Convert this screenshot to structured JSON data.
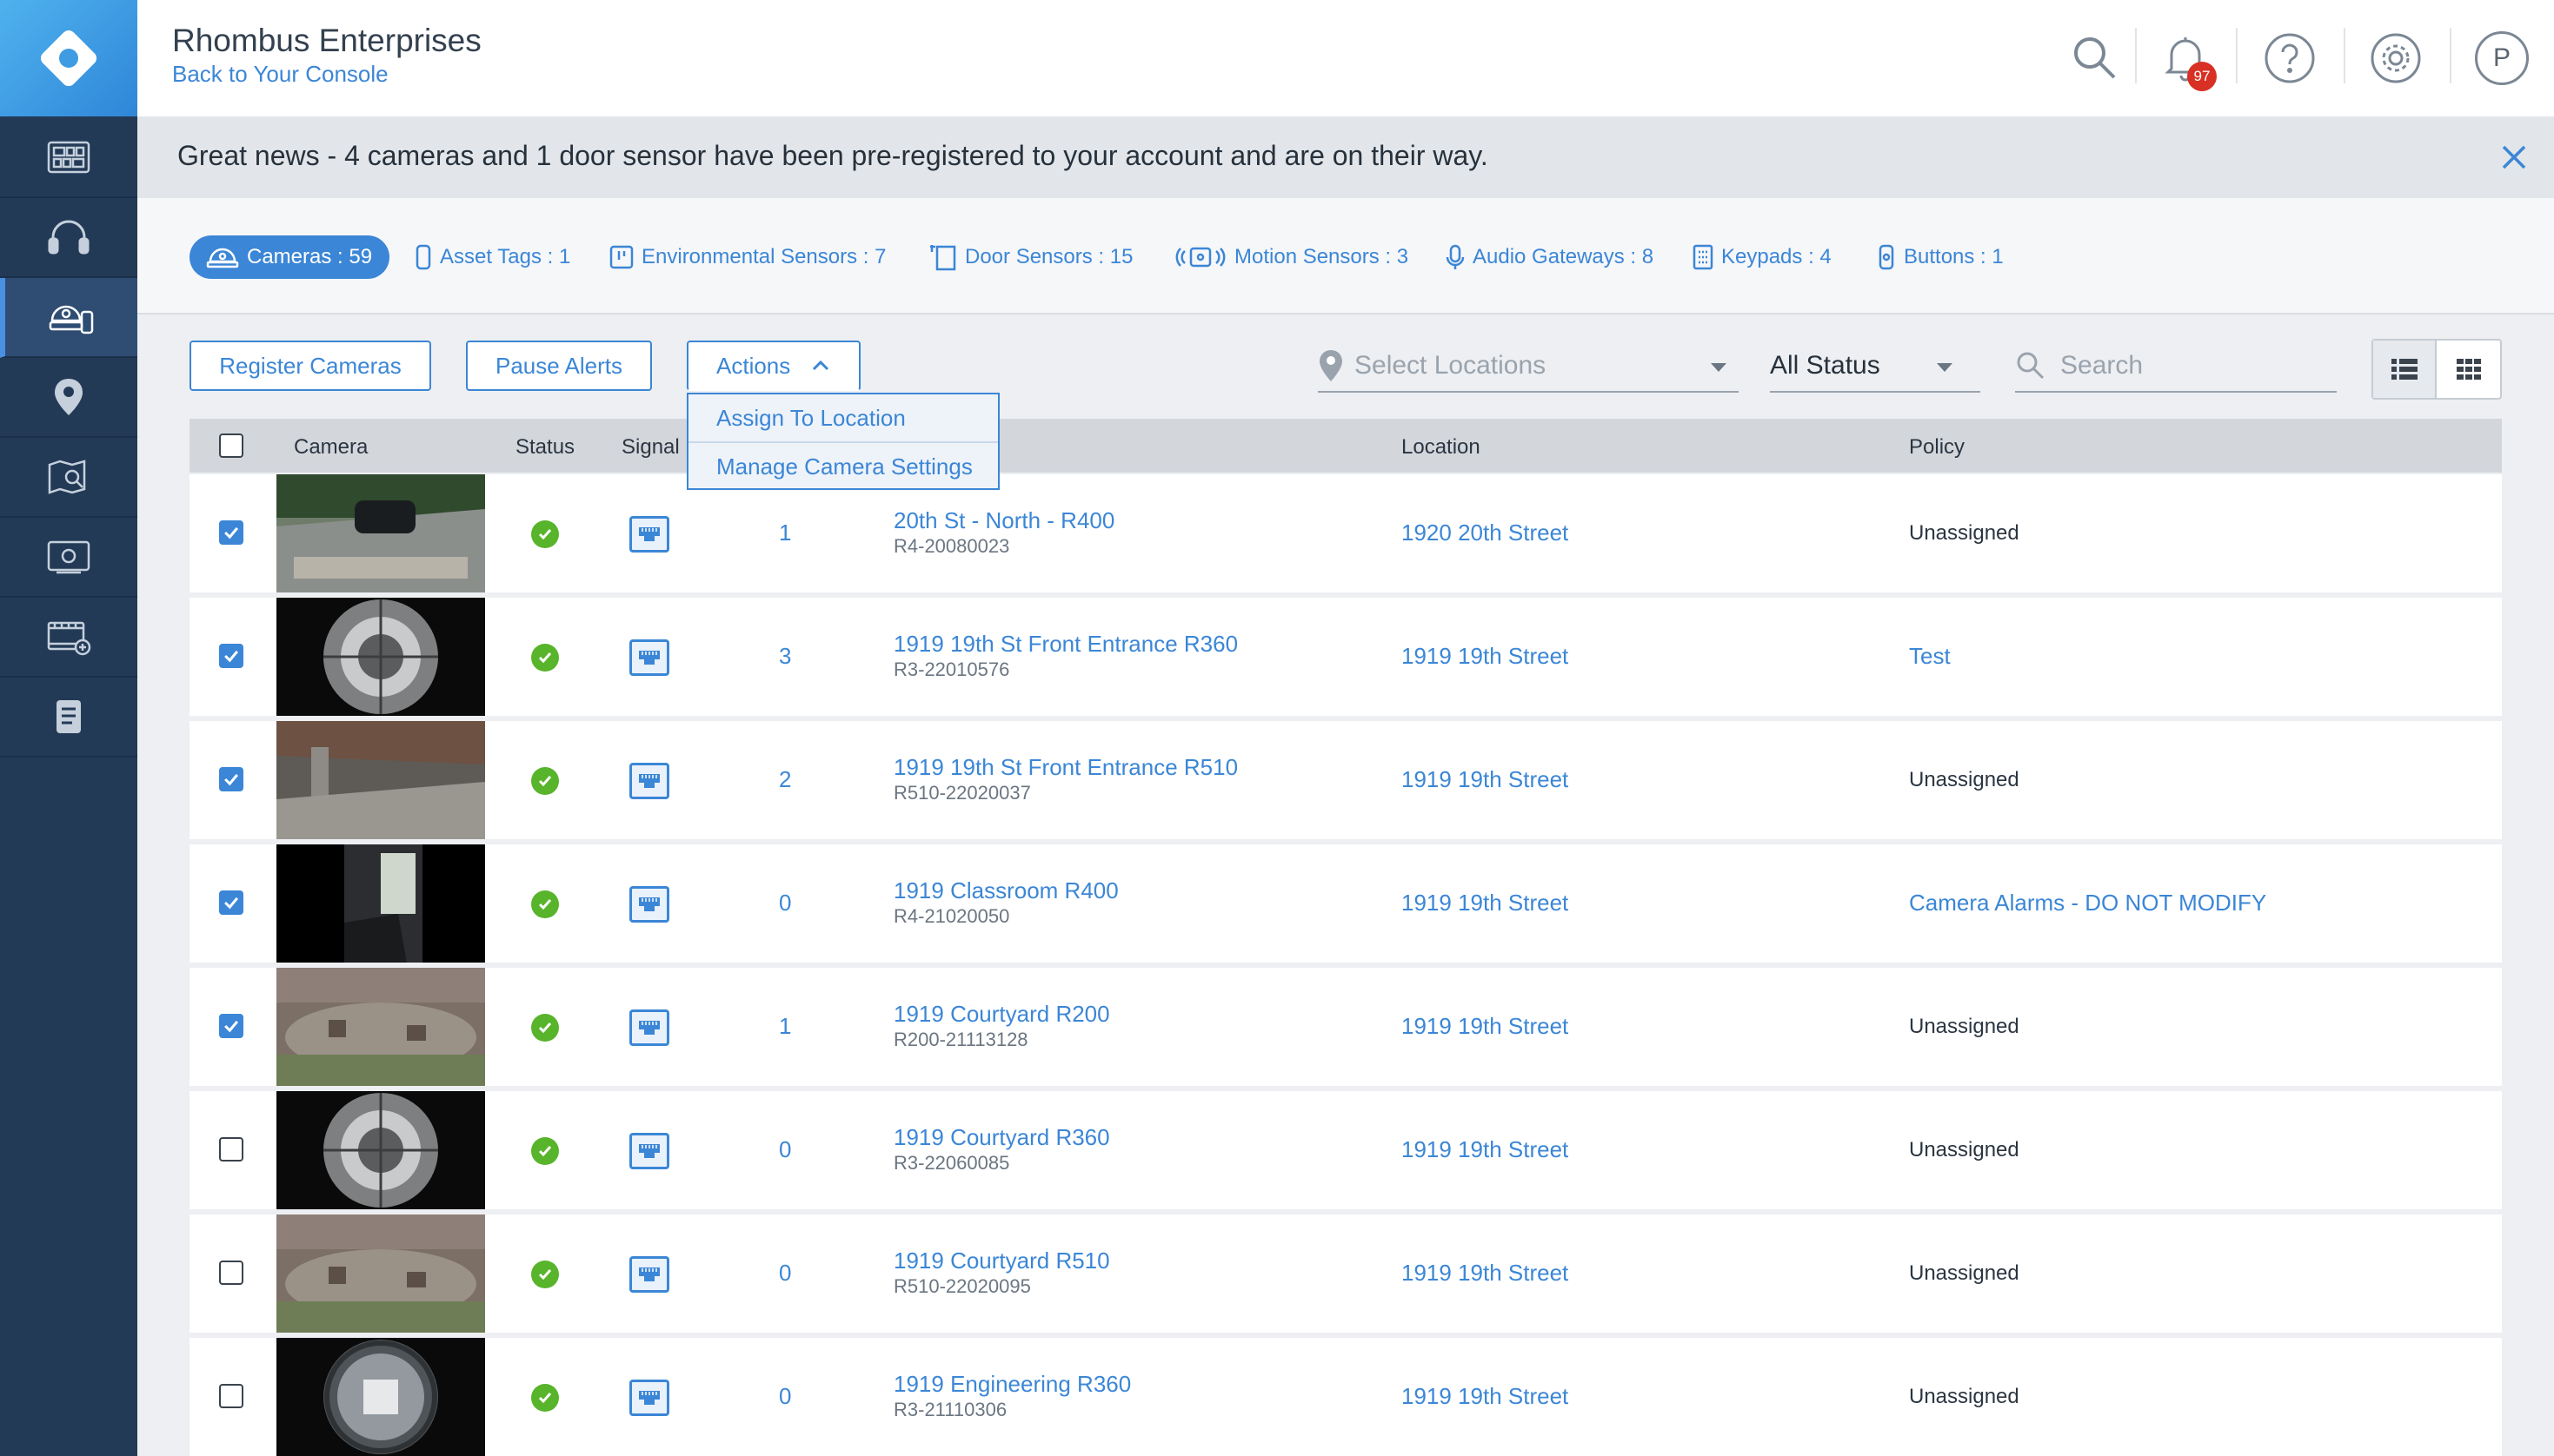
{
  "header": {
    "org_name": "Rhombus Enterprises",
    "back_link": "Back to Your Console",
    "notification_count": "97",
    "avatar_initial": "P"
  },
  "sidebar": {
    "items": [
      {
        "icon": "dashboard-icon"
      },
      {
        "icon": "headset-icon"
      },
      {
        "icon": "devices-icon",
        "active": true
      },
      {
        "icon": "location-pin-icon"
      },
      {
        "icon": "map-search-icon"
      },
      {
        "icon": "video-wall-icon"
      },
      {
        "icon": "clips-icon"
      },
      {
        "icon": "reports-icon"
      }
    ]
  },
  "banner": {
    "text": "Great news - 4 cameras and 1 door sensor have been pre-registered to your account and are on their way."
  },
  "device_tabs": [
    {
      "label": "Cameras : 59",
      "icon": "camera-icon",
      "active": true
    },
    {
      "label": "Asset Tags : 1",
      "icon": "asset-tag-icon"
    },
    {
      "label": "Environmental Sensors : 7",
      "icon": "environmental-sensor-icon"
    },
    {
      "label": "Door Sensors : 15",
      "icon": "door-sensor-icon"
    },
    {
      "label": "Motion Sensors : 3",
      "icon": "motion-sensor-icon"
    },
    {
      "label": "Audio Gateways : 8",
      "icon": "microphone-icon"
    },
    {
      "label": "Keypads : 4",
      "icon": "keypad-icon"
    },
    {
      "label": "Buttons : 1",
      "icon": "button-device-icon"
    }
  ],
  "toolbar": {
    "register_label": "Register Cameras",
    "pause_label": "Pause Alerts",
    "actions_label": "Actions",
    "actions_menu": [
      "Assign To Location",
      "Manage Camera Settings"
    ],
    "locations_placeholder": "Select Locations",
    "status_value": "All Status",
    "search_placeholder": "Search"
  },
  "table": {
    "headers": {
      "camera": "Camera",
      "status": "Status",
      "signal": "Signal",
      "location": "Location",
      "policy": "Policy"
    },
    "rows": [
      {
        "checked": true,
        "count": "1",
        "name": "20th St - North - R400",
        "serial": "R4-20080023",
        "location": "1920 20th Street",
        "policy": "Unassigned",
        "policy_link": false,
        "thumb": "outdoor"
      },
      {
        "checked": true,
        "count": "3",
        "name": "1919 19th St Front Entrance R360",
        "serial": "R3-22010576",
        "location": "1919 19th Street",
        "policy": "Test",
        "policy_link": true,
        "thumb": "fisheye"
      },
      {
        "checked": true,
        "count": "2",
        "name": "1919 19th St Front Entrance R510",
        "serial": "R510-22020037",
        "location": "1919 19th Street",
        "policy": "Unassigned",
        "policy_link": false,
        "thumb": "entrance"
      },
      {
        "checked": true,
        "count": "0",
        "name": "1919 Classroom R400",
        "serial": "R4-21020050",
        "location": "1919 19th Street",
        "policy": "Camera Alarms - DO NOT MODIFY",
        "policy_link": true,
        "thumb": "classroom"
      },
      {
        "checked": true,
        "count": "1",
        "name": "1919 Courtyard R200",
        "serial": "R200-21113128",
        "location": "1919 19th Street",
        "policy": "Unassigned",
        "policy_link": false,
        "thumb": "courtyard"
      },
      {
        "checked": false,
        "count": "0",
        "name": "1919 Courtyard R360",
        "serial": "R3-22060085",
        "location": "1919 19th Street",
        "policy": "Unassigned",
        "policy_link": false,
        "thumb": "fisheye"
      },
      {
        "checked": false,
        "count": "0",
        "name": "1919 Courtyard R510",
        "serial": "R510-22020095",
        "location": "1919 19th Street",
        "policy": "Unassigned",
        "policy_link": false,
        "thumb": "courtyard"
      },
      {
        "checked": false,
        "count": "0",
        "name": "1919 Engineering R360",
        "serial": "R3-21110306",
        "location": "1919 19th Street",
        "policy": "Unassigned",
        "policy_link": false,
        "thumb": "fisheye2"
      }
    ]
  }
}
